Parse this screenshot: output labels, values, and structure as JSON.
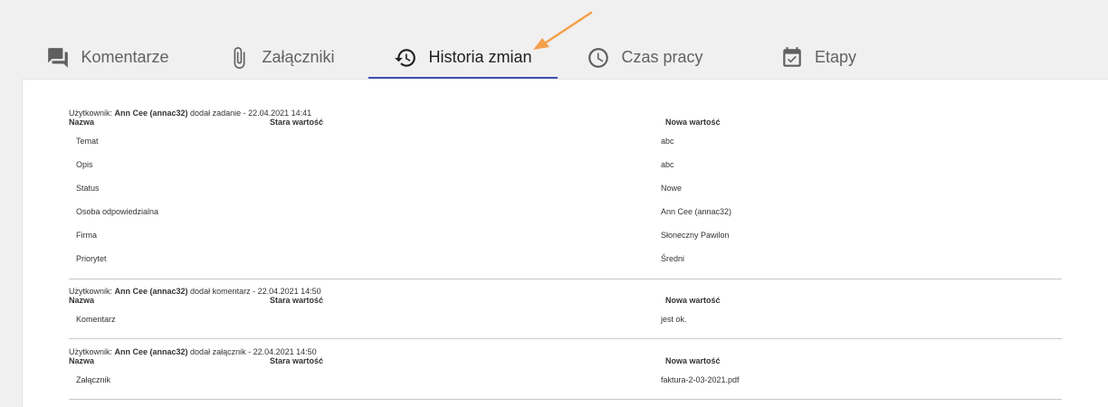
{
  "tabs": [
    {
      "label": "Komentarze",
      "icon": "comment-icon"
    },
    {
      "label": "Załączniki",
      "icon": "paperclip-icon"
    },
    {
      "label": "Historia zmian",
      "icon": "history-icon",
      "active": true
    },
    {
      "label": "Czas pracy",
      "icon": "clock-icon"
    },
    {
      "label": "Etapy",
      "icon": "calendar-check-icon"
    }
  ],
  "columns": {
    "name": "Nazwa",
    "old": "Stara wartość",
    "new": "Nowa wartość"
  },
  "entries": [
    {
      "user_prefix": "Użytkownik: ",
      "user": "Ann Cee (annac32)",
      "action": " dodał zadanie - 22.04.2021 14:41",
      "rows": [
        {
          "name": "Temat",
          "new": "abc"
        },
        {
          "name": "Opis",
          "new": "abc"
        },
        {
          "name": "Status",
          "new": "Nowe"
        },
        {
          "name": "Osoba odpowiedzialna",
          "new": "Ann Cee (annac32)"
        },
        {
          "name": "Firma",
          "new": "Słoneczny Pawilon"
        },
        {
          "name": "Priorytet",
          "new": "Średni"
        }
      ]
    },
    {
      "user_prefix": "Użytkownik: ",
      "user": "Ann Cee (annac32)",
      "action": " dodał komentarz - 22.04.2021 14:50",
      "rows": [
        {
          "name": "Komentarz",
          "new": "jest ok."
        }
      ]
    },
    {
      "user_prefix": "Użytkownik: ",
      "user": "Ann Cee (annac32)",
      "action": " dodał załącznik - 22.04.2021 14:50",
      "rows": [
        {
          "name": "Załącznik",
          "new": "faktura-2-03-2021.pdf"
        }
      ]
    }
  ],
  "colors": {
    "accent": "#3f51b5",
    "arrow": "#f5a04a",
    "icon": "#5f5f5f"
  }
}
